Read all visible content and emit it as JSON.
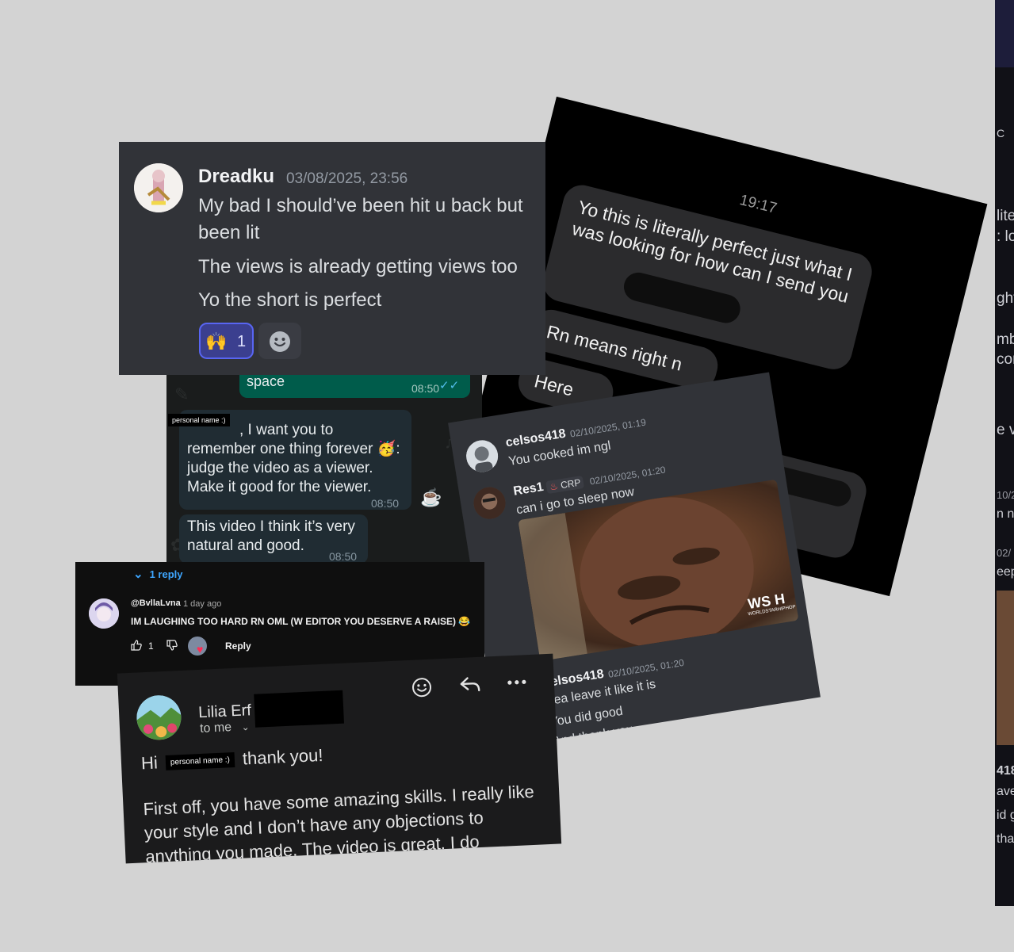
{
  "background_panel": {
    "fragments": [
      "lite",
      ": lo",
      "ght",
      "mb",
      "con",
      "e v",
      "10/2",
      "n ng",
      "02/",
      "eep",
      "418",
      "ave",
      "id g",
      "tha",
      "C"
    ]
  },
  "imessage": {
    "time": "19:17",
    "bubble1": "Yo this is literally perfect just what I was looking for how can I send you",
    "bubble2": "Rn means right n",
    "bubble3": "Here"
  },
  "discord_top": {
    "username": "Dreadku",
    "timestamp": "03/08/2025, 23:56",
    "messages": [
      "My bad I should’ve been hit u back but been lit",
      "The views is already getting views too",
      "Yo the short is perfect"
    ],
    "reaction_emoji": "🙌",
    "reaction_count": "1",
    "add_reaction_icon": "smile-icon"
  },
  "whatsapp": {
    "top_message": "space",
    "top_time": "08:50",
    "personal_label": "personal name :)",
    "message2": ", I want you to remember one thing forever 🥳: judge the video as a viewer. Make it good for the viewer.",
    "message2_time": "08:50",
    "message3": "This video I think it’s very natural and good.",
    "message3_time": "08:50"
  },
  "discord_second": {
    "messages": [
      {
        "user": "celsos418",
        "date": "02/10/2025, 01:19",
        "text": "You cooked im ngl"
      },
      {
        "user": "Res1",
        "badge": "CRP",
        "date": "02/10/2025, 01:20",
        "text": "can i go to sleep now"
      },
      {
        "user": "celsos418",
        "date": "02/10/2025, 01:20",
        "lines": [
          "Yea leave it like it is",
          "You did good",
          "And thank you"
        ]
      }
    ],
    "gif_watermark": "WS H",
    "gif_watermark_sub": "WORLDSTARHIPHOP"
  },
  "youtube": {
    "replies_toggle": "1 reply",
    "handle": "@BvllaLvna",
    "ago": "1 day ago",
    "comment": "IM LAUGHING TOO HARD RN OML (W EDITOR YOU DESERVE A RAISE) 😂",
    "likes": "1",
    "reply_label": "Reply"
  },
  "email": {
    "sender": "Lilia Erf",
    "to_me": "to me",
    "greeting_pre": "Hi",
    "personal_label": "personal name :)",
    "greeting_post": "thank you!",
    "body": "First off, you have some amazing skills. I really like your style and I don’t have any objections to anything you made. The video is great. I do"
  }
}
